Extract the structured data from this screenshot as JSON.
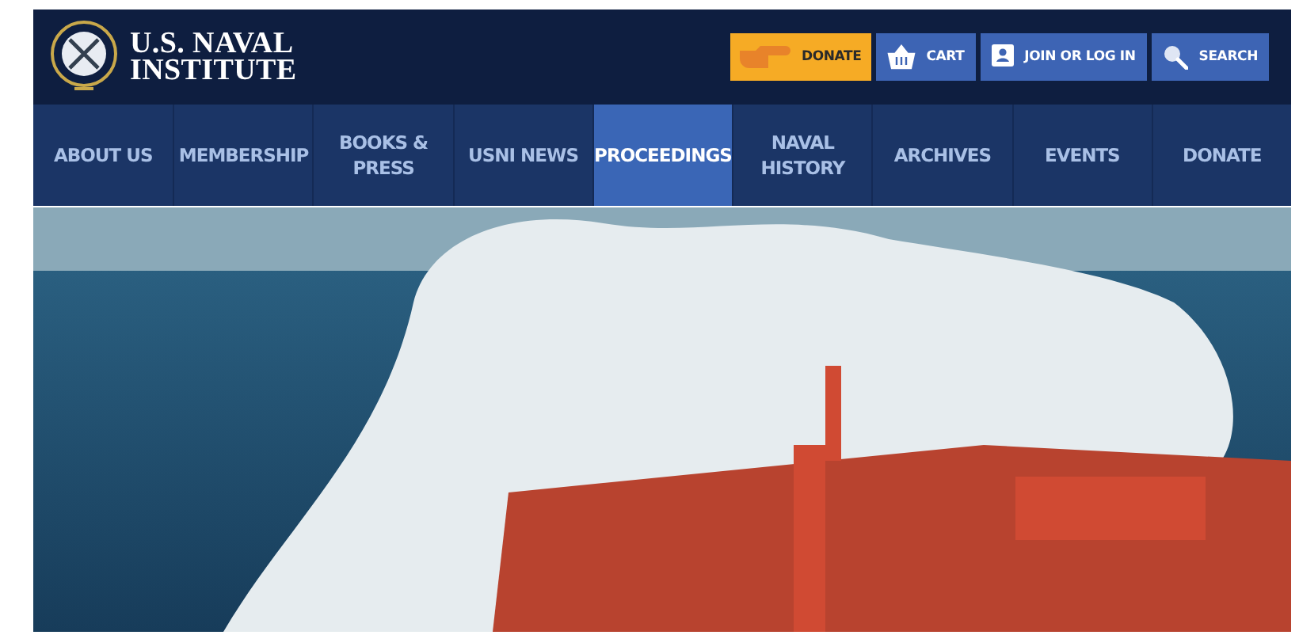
{
  "logo": {
    "line_1": "U.S. NAVAL",
    "line_2": "INSTITUTE"
  },
  "actions": [
    {
      "kind": "donate",
      "label": "DONATE"
    },
    {
      "kind": "cart",
      "label": "CART"
    },
    {
      "kind": "account",
      "label": "JOIN OR LOG IN"
    },
    {
      "kind": "search",
      "label": "SEARCH"
    }
  ],
  "nav": [
    {
      "label": "ABOUT US",
      "selected": false
    },
    {
      "label": "MEMBERSHIP",
      "selected": false
    },
    {
      "label": "BOOKS &\nPRESS",
      "selected": false
    },
    {
      "label": "USNI NEWS",
      "selected": false
    },
    {
      "label": "PROCEEDINGS",
      "selected": true
    },
    {
      "label": "NAVAL\nHISTORY",
      "selected": false
    },
    {
      "label": "ARCHIVES",
      "selected": false
    },
    {
      "label": "EVENTS",
      "selected": false
    },
    {
      "label": "DONATE",
      "selected": false
    }
  ]
}
